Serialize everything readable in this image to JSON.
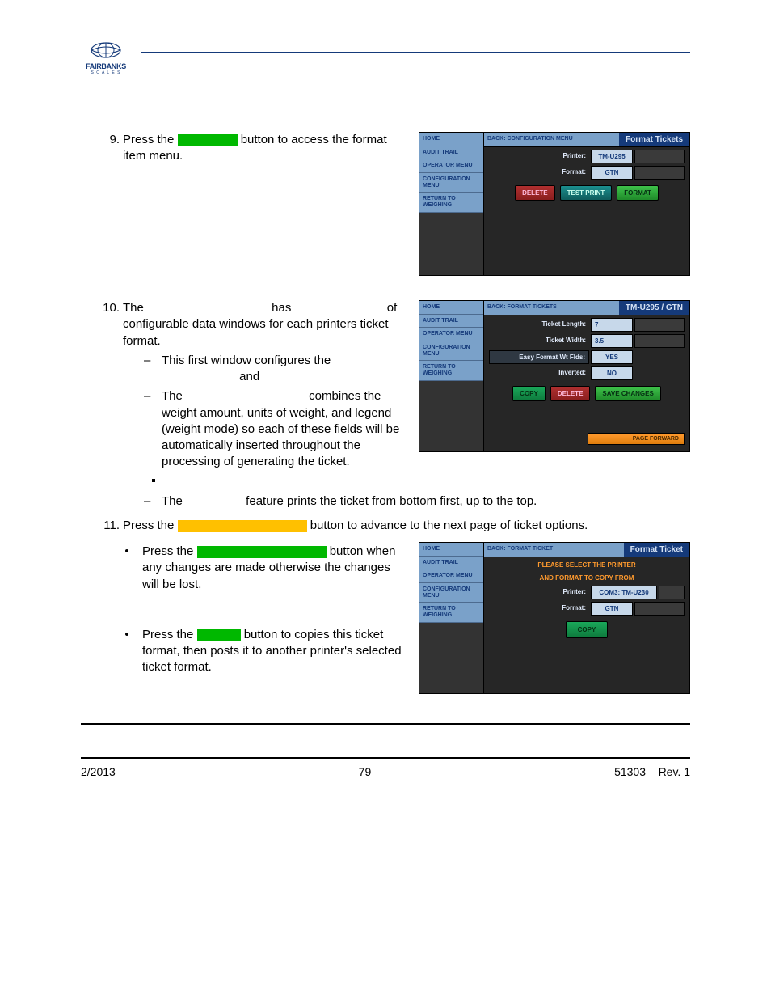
{
  "logo": {
    "brand": "FAIRBANKS",
    "sub": "S C A L E S"
  },
  "step9": {
    "num": "9.",
    "before": "Press the ",
    "after": " button to access the format item menu."
  },
  "step10": {
    "num": "10.",
    "l1a": "The ",
    "l1b": " has",
    "l2": " of configurable data windows for each printers ticket format.",
    "d1a": "This first window configures the ",
    "d1b": " and",
    "d2a": "The ",
    "d2b": " combines the weight amount, units of weight, and legend (weight mode) so each of these fields will be automatically inserted throughout the processing of generating the ticket.",
    "d3a": "The ",
    "d3b": " feature prints the ticket from bottom first, up to the top."
  },
  "step11": {
    "num": "11.",
    "before": "Press the ",
    "after": " button to advance to the next page of ticket options."
  },
  "bullet_save": {
    "before": "Press the ",
    "after": " button when any changes are made otherwise the changes will be lost."
  },
  "bullet_copy": {
    "before": "Press the ",
    "after": " button to copies this ticket format, then posts it to another printer's selected ticket format."
  },
  "shot1": {
    "menu": [
      "HOME",
      "AUDIT TRAIL",
      "OPERATOR MENU",
      "CONFIGURATION MENU",
      "RETURN TO WEIGHING"
    ],
    "back": "BACK: CONFIGURATION MENU",
    "title": "Format Tickets",
    "printer_lbl": "Printer:",
    "printer_val": "TM-U295",
    "format_lbl": "Format:",
    "format_val": "GTN",
    "btn_delete": "DELETE",
    "btn_test": "TEST PRINT",
    "btn_format": "FORMAT"
  },
  "shot2": {
    "menu": [
      "HOME",
      "AUDIT TRAIL",
      "OPERATOR MENU",
      "CONFIGURATION MENU",
      "RETURN TO WEIGHING"
    ],
    "back": "BACK: FORMAT TICKETS",
    "title": "TM-U295 / GTN",
    "len_lbl": "Ticket Length:",
    "len_val": "7",
    "wid_lbl": "Ticket Width:",
    "wid_val": "3.5",
    "easy_lbl": "Easy Format Wt Flds:",
    "easy_val": "YES",
    "inv_lbl": "Inverted:",
    "inv_val": "NO",
    "btn_copy": "COPY",
    "btn_delete": "DELETE",
    "btn_save": "SAVE CHANGES",
    "pagefwd": "PAGE FORWARD"
  },
  "shot3": {
    "menu": [
      "HOME",
      "AUDIT TRAIL",
      "OPERATOR MENU",
      "CONFIGURATION MENU",
      "RETURN TO WEIGHING"
    ],
    "back": "BACK: FORMAT TICKET",
    "title": "Format Ticket",
    "msg1": "PLEASE SELECT THE PRINTER",
    "msg2": "AND FORMAT TO COPY FROM",
    "printer_lbl": "Printer:",
    "printer_val": "COM3: TM-U230",
    "format_lbl": "Format:",
    "format_val": "GTN",
    "btn_copy": "COPY"
  },
  "footer": {
    "date": "2/2013",
    "page": "79",
    "doc": "51303",
    "rev": "Rev. 1"
  }
}
